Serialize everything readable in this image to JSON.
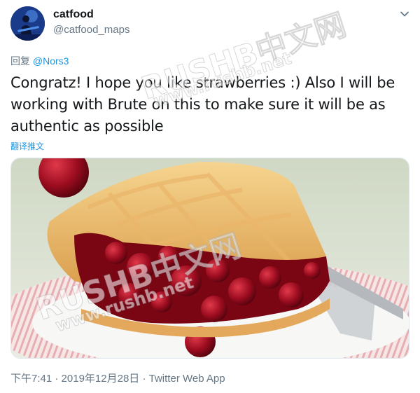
{
  "user": {
    "display_name": "catfood",
    "handle": "@catfood_maps"
  },
  "reply": {
    "prefix": "回复 ",
    "mention": "@Nors3"
  },
  "tweet": {
    "text": "Congratz! I hope you like strawberries :) Also I will be working with Brute on this to make sure it will be as authentic as possible",
    "translate_label": "翻译推文"
  },
  "media": {
    "icon": "cherry-pie-photo"
  },
  "meta": {
    "time": "下午7:41",
    "separator": " · ",
    "date": "2019年12月28日",
    "source": "Twitter Web App"
  },
  "watermark": {
    "brand": "RUSHB中文网",
    "site": "www.rushb.net"
  },
  "colors": {
    "link": "#1b95e0",
    "secondary_text": "#657786",
    "primary_text": "#14171a"
  }
}
